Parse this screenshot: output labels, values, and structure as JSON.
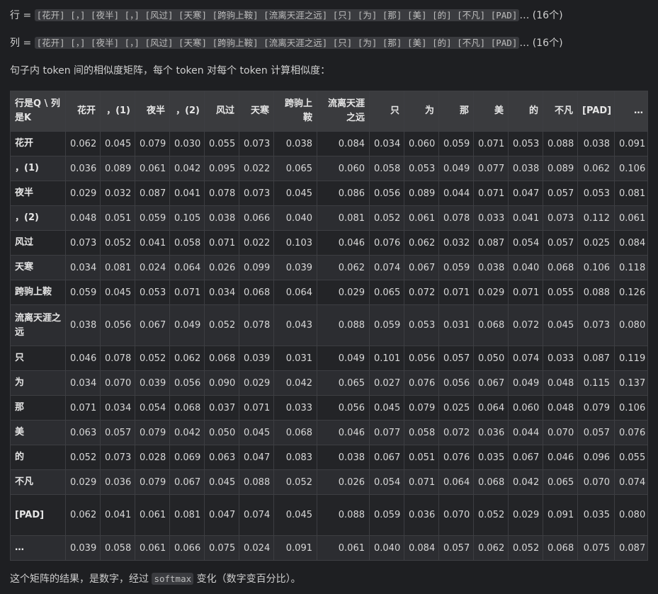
{
  "line1": {
    "prefix": "行 = ",
    "tokens": "[花开] [，] [夜半] [，] [风过] [天寒] [跨驹上鞍] [流离天涯之远] [只] [为] [那] [美] [的] [不凡] [PAD]",
    "suffix": "… (16个)"
  },
  "line2": {
    "prefix": "列 = ",
    "tokens": "[花开] [，] [夜半] [，] [风过] [天寒] [跨驹上鞍] [流离天涯之远] [只] [为] [那] [美] [的] [不凡] [PAD]",
    "suffix": "… (16个)"
  },
  "description": "句子内 token 间的相似度矩阵，每个 token 对每个 token 计算相似度：",
  "table": {
    "corner": "行是Q \\ 列是K",
    "headers": [
      "花开",
      "，(1)",
      "夜半",
      "，(2)",
      "风过",
      "天寒",
      "跨驹上鞍",
      "流离天涯之远",
      "只",
      "为",
      "那",
      "美",
      "的",
      "不凡",
      "[PAD]",
      "…"
    ],
    "rows": [
      {
        "label": "花开",
        "values": [
          "0.062",
          "0.045",
          "0.079",
          "0.030",
          "0.055",
          "0.073",
          "0.038",
          "0.084",
          "0.034",
          "0.060",
          "0.059",
          "0.071",
          "0.053",
          "0.088",
          "0.038",
          "0.091"
        ]
      },
      {
        "label": "，(1)",
        "values": [
          "0.036",
          "0.089",
          "0.061",
          "0.042",
          "0.095",
          "0.022",
          "0.065",
          "0.060",
          "0.058",
          "0.053",
          "0.049",
          "0.077",
          "0.038",
          "0.089",
          "0.062",
          "0.106"
        ]
      },
      {
        "label": "夜半",
        "values": [
          "0.029",
          "0.032",
          "0.087",
          "0.041",
          "0.078",
          "0.073",
          "0.045",
          "0.086",
          "0.056",
          "0.089",
          "0.044",
          "0.071",
          "0.047",
          "0.057",
          "0.053",
          "0.081"
        ]
      },
      {
        "label": "，(2)",
        "values": [
          "0.048",
          "0.051",
          "0.059",
          "0.105",
          "0.038",
          "0.066",
          "0.040",
          "0.081",
          "0.052",
          "0.061",
          "0.078",
          "0.033",
          "0.041",
          "0.073",
          "0.112",
          "0.061"
        ]
      },
      {
        "label": "风过",
        "values": [
          "0.073",
          "0.052",
          "0.041",
          "0.058",
          "0.071",
          "0.022",
          "0.103",
          "0.046",
          "0.076",
          "0.062",
          "0.032",
          "0.087",
          "0.054",
          "0.057",
          "0.025",
          "0.084"
        ]
      },
      {
        "label": "天寒",
        "values": [
          "0.034",
          "0.081",
          "0.024",
          "0.064",
          "0.026",
          "0.099",
          "0.039",
          "0.062",
          "0.074",
          "0.067",
          "0.059",
          "0.038",
          "0.040",
          "0.068",
          "0.106",
          "0.118"
        ]
      },
      {
        "label": "跨驹上鞍",
        "values": [
          "0.059",
          "0.045",
          "0.053",
          "0.071",
          "0.034",
          "0.068",
          "0.064",
          "0.029",
          "0.065",
          "0.072",
          "0.071",
          "0.029",
          "0.071",
          "0.055",
          "0.088",
          "0.126"
        ]
      },
      {
        "label": "流离天涯之远",
        "values": [
          "0.038",
          "0.056",
          "0.067",
          "0.049",
          "0.052",
          "0.078",
          "0.043",
          "0.088",
          "0.059",
          "0.053",
          "0.031",
          "0.068",
          "0.072",
          "0.045",
          "0.073",
          "0.080"
        ]
      },
      {
        "label": "只",
        "values": [
          "0.046",
          "0.078",
          "0.052",
          "0.062",
          "0.068",
          "0.039",
          "0.031",
          "0.049",
          "0.101",
          "0.056",
          "0.057",
          "0.050",
          "0.074",
          "0.033",
          "0.087",
          "0.119"
        ]
      },
      {
        "label": "为",
        "values": [
          "0.034",
          "0.070",
          "0.039",
          "0.056",
          "0.090",
          "0.029",
          "0.042",
          "0.065",
          "0.027",
          "0.076",
          "0.056",
          "0.067",
          "0.049",
          "0.048",
          "0.115",
          "0.137"
        ]
      },
      {
        "label": "那",
        "values": [
          "0.071",
          "0.034",
          "0.054",
          "0.068",
          "0.037",
          "0.071",
          "0.033",
          "0.056",
          "0.045",
          "0.079",
          "0.025",
          "0.064",
          "0.060",
          "0.048",
          "0.079",
          "0.106"
        ]
      },
      {
        "label": "美",
        "values": [
          "0.063",
          "0.057",
          "0.079",
          "0.042",
          "0.050",
          "0.045",
          "0.068",
          "0.046",
          "0.077",
          "0.058",
          "0.072",
          "0.036",
          "0.044",
          "0.070",
          "0.057",
          "0.076"
        ]
      },
      {
        "label": "的",
        "values": [
          "0.052",
          "0.073",
          "0.028",
          "0.069",
          "0.063",
          "0.047",
          "0.083",
          "0.038",
          "0.067",
          "0.051",
          "0.076",
          "0.035",
          "0.067",
          "0.046",
          "0.096",
          "0.055"
        ]
      },
      {
        "label": "不凡",
        "values": [
          "0.029",
          "0.036",
          "0.079",
          "0.067",
          "0.045",
          "0.088",
          "0.052",
          "0.026",
          "0.054",
          "0.071",
          "0.064",
          "0.068",
          "0.042",
          "0.065",
          "0.070",
          "0.074"
        ]
      },
      {
        "label": "[PAD]",
        "values": [
          "0.062",
          "0.041",
          "0.061",
          "0.081",
          "0.047",
          "0.074",
          "0.045",
          "0.088",
          "0.059",
          "0.036",
          "0.070",
          "0.052",
          "0.029",
          "0.091",
          "0.035",
          "0.080"
        ]
      },
      {
        "label": "…",
        "values": [
          "0.039",
          "0.058",
          "0.061",
          "0.066",
          "0.075",
          "0.024",
          "0.091",
          "0.061",
          "0.040",
          "0.084",
          "0.057",
          "0.062",
          "0.052",
          "0.068",
          "0.075",
          "0.087"
        ]
      }
    ]
  },
  "footer": {
    "before": "这个矩阵的结果，是数字，经过 ",
    "code": "softmax",
    "after": " 变化（数字变百分比）。"
  }
}
